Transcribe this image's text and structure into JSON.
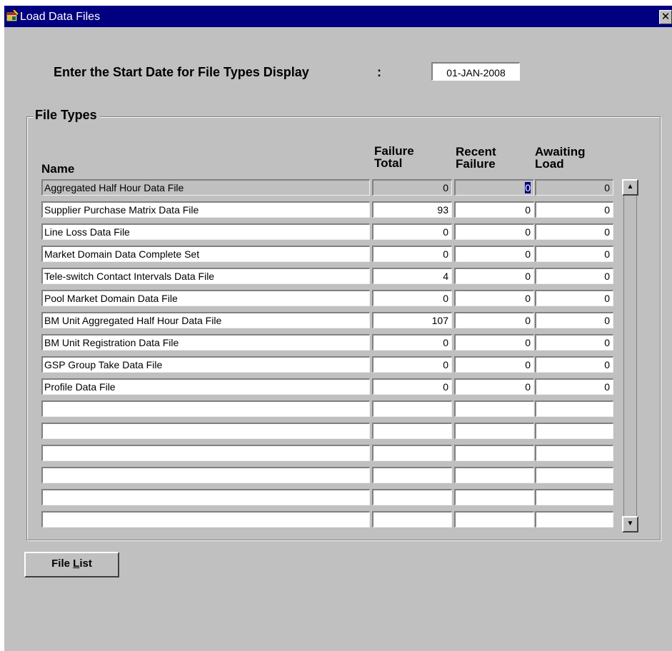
{
  "window": {
    "title": "Load Data Files",
    "close_glyph": "✕",
    "icon": "app-window-icon"
  },
  "start_date": {
    "label": "Enter the Start Date for File Types Display",
    "colon": ":",
    "value": "01-JAN-2008"
  },
  "file_types": {
    "group_title": "File Types",
    "headers": {
      "name": "Name",
      "failure_total": [
        "Failure",
        "Total"
      ],
      "recent_failure": [
        "Recent",
        "Failure"
      ],
      "awaiting_load": [
        "Awaiting",
        "Load"
      ]
    },
    "rows": [
      {
        "name": "Aggregated Half Hour Data File",
        "failure_total": "0",
        "recent_failure": "0",
        "awaiting_load": "0",
        "selected": true
      },
      {
        "name": "Supplier Purchase Matrix Data File",
        "failure_total": "93",
        "recent_failure": "0",
        "awaiting_load": "0"
      },
      {
        "name": "Line Loss Data File",
        "failure_total": "0",
        "recent_failure": "0",
        "awaiting_load": "0"
      },
      {
        "name": "Market Domain Data Complete Set",
        "failure_total": "0",
        "recent_failure": "0",
        "awaiting_load": "0"
      },
      {
        "name": "Tele-switch Contact Intervals Data File",
        "failure_total": "4",
        "recent_failure": "0",
        "awaiting_load": "0"
      },
      {
        "name": "Pool Market Domain Data File",
        "failure_total": "0",
        "recent_failure": "0",
        "awaiting_load": "0"
      },
      {
        "name": "BM Unit Aggregated Half Hour Data File",
        "failure_total": "107",
        "recent_failure": "0",
        "awaiting_load": "0"
      },
      {
        "name": "BM Unit Registration Data File",
        "failure_total": "0",
        "recent_failure": "0",
        "awaiting_load": "0"
      },
      {
        "name": "GSP Group Take Data File",
        "failure_total": "0",
        "recent_failure": "0",
        "awaiting_load": "0"
      },
      {
        "name": "Profile Data File",
        "failure_total": "0",
        "recent_failure": "0",
        "awaiting_load": "0"
      },
      {
        "name": "",
        "failure_total": "",
        "recent_failure": "",
        "awaiting_load": ""
      },
      {
        "name": "",
        "failure_total": "",
        "recent_failure": "",
        "awaiting_load": ""
      },
      {
        "name": "",
        "failure_total": "",
        "recent_failure": "",
        "awaiting_load": ""
      },
      {
        "name": "",
        "failure_total": "",
        "recent_failure": "",
        "awaiting_load": ""
      },
      {
        "name": "",
        "failure_total": "",
        "recent_failure": "",
        "awaiting_load": ""
      },
      {
        "name": "",
        "failure_total": "",
        "recent_failure": "",
        "awaiting_load": ""
      }
    ]
  },
  "scrollbar": {
    "up_glyph": "▲",
    "down_glyph": "▼"
  },
  "buttons": {
    "file_list": {
      "before": "File ",
      "mnemonic": "L",
      "after": "ist"
    }
  }
}
